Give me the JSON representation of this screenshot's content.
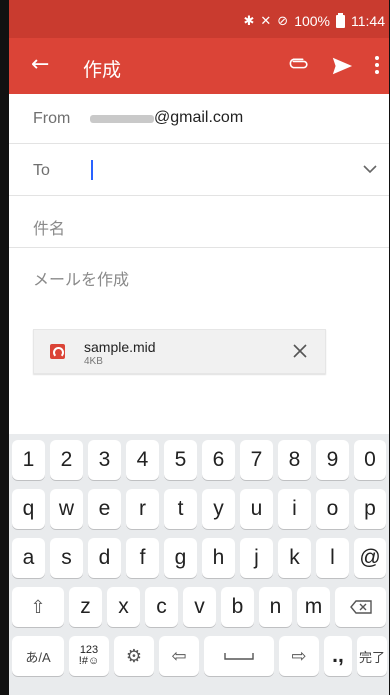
{
  "status": {
    "time": "11:44",
    "battery": "100%",
    "icons": [
      "bluetooth-icon",
      "vibrate-icon",
      "no-signal-icon",
      "battery-icon"
    ]
  },
  "appbar": {
    "title": "作成",
    "color": "#db4437",
    "status_color": "#c93b2f"
  },
  "compose": {
    "from_label": "From",
    "from_domain": "@gmail.com",
    "to_label": "To",
    "subject_placeholder": "件名",
    "body_placeholder": "メールを作成"
  },
  "attachment": {
    "name": "sample.mid",
    "size": "4KB"
  },
  "keyboard": {
    "numbers": [
      "1",
      "2",
      "3",
      "4",
      "5",
      "6",
      "7",
      "8",
      "9",
      "0"
    ],
    "row1": [
      "q",
      "w",
      "e",
      "r",
      "t",
      "y",
      "u",
      "i",
      "o",
      "p"
    ],
    "row2": [
      "a",
      "s",
      "d",
      "f",
      "g",
      "h",
      "j",
      "k",
      "l",
      "@"
    ],
    "row3": [
      "z",
      "x",
      "c",
      "v",
      "b",
      "n",
      "m"
    ],
    "mode_key": "あ/A",
    "symbols_key_top": "123",
    "symbols_key_bottom": "!#☺",
    "punct_key": ".,",
    "done_key": "完了"
  }
}
